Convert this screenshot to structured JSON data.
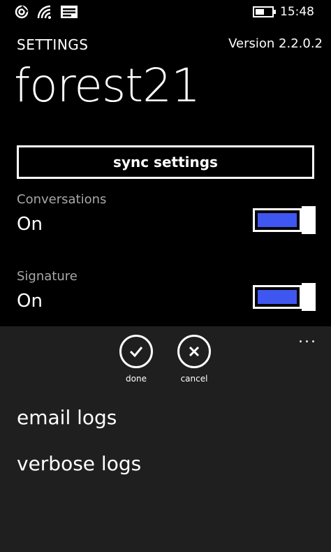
{
  "status_bar": {
    "time": "15:48",
    "icons": [
      "data-icon",
      "wifi-icon",
      "message-icon",
      "battery-icon"
    ]
  },
  "header": {
    "page_label": "SETTINGS",
    "version": "Version 2.2.0.2",
    "title": "forest21"
  },
  "sync_button": {
    "label": "sync settings"
  },
  "settings": [
    {
      "label": "Conversations",
      "value": "On",
      "enabled": true
    },
    {
      "label": "Signature",
      "value": "On",
      "enabled": true
    }
  ],
  "app_bar": {
    "buttons": [
      {
        "label": "done",
        "icon": "check-icon"
      },
      {
        "label": "cancel",
        "icon": "close-icon"
      }
    ],
    "more": "...",
    "menu_items": [
      "email logs",
      "verbose logs"
    ]
  },
  "colors": {
    "accent": "#3f56f0",
    "background": "#000000",
    "app_bar": "#1f1f1f",
    "subtle_text": "#a8a8a8"
  }
}
